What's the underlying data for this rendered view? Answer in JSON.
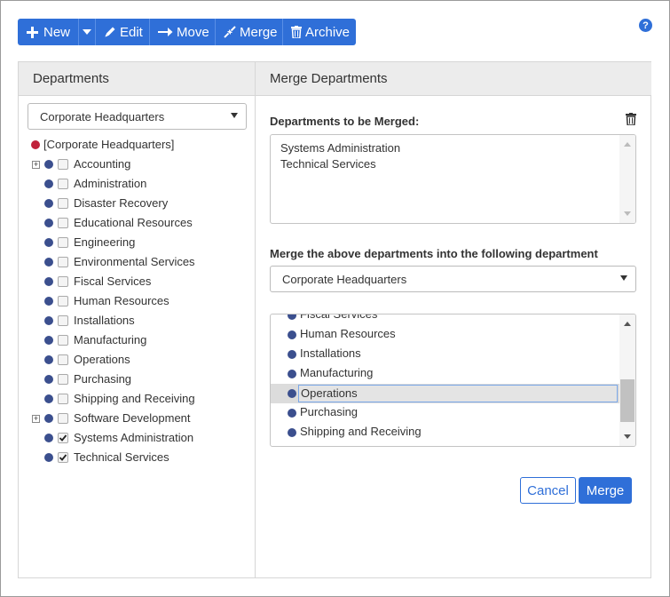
{
  "toolbar": {
    "new_label": "New",
    "edit_label": "Edit",
    "move_label": "Move",
    "merge_label": "Merge",
    "archive_label": "Archive"
  },
  "help_label": "?",
  "left_panel": {
    "title": "Departments",
    "select_value": "Corporate Headquarters",
    "root_label": "[Corporate Headquarters]",
    "items": [
      {
        "label": "Accounting",
        "expandable": true,
        "checked": false
      },
      {
        "label": "Administration",
        "expandable": false,
        "checked": false
      },
      {
        "label": "Disaster Recovery",
        "expandable": false,
        "checked": false
      },
      {
        "label": "Educational Resources",
        "expandable": false,
        "checked": false
      },
      {
        "label": "Engineering",
        "expandable": false,
        "checked": false
      },
      {
        "label": "Environmental Services",
        "expandable": false,
        "checked": false
      },
      {
        "label": "Fiscal Services",
        "expandable": false,
        "checked": false
      },
      {
        "label": "Human Resources",
        "expandable": false,
        "checked": false
      },
      {
        "label": "Installations",
        "expandable": false,
        "checked": false
      },
      {
        "label": "Manufacturing",
        "expandable": false,
        "checked": false
      },
      {
        "label": "Operations",
        "expandable": false,
        "checked": false
      },
      {
        "label": "Purchasing",
        "expandable": false,
        "checked": false
      },
      {
        "label": "Shipping and Receiving",
        "expandable": false,
        "checked": false
      },
      {
        "label": "Software Development",
        "expandable": true,
        "checked": false
      },
      {
        "label": "Systems Administration",
        "expandable": false,
        "checked": true
      },
      {
        "label": "Technical Services",
        "expandable": false,
        "checked": true
      }
    ]
  },
  "right_panel": {
    "title": "Merge Departments",
    "merged_label": "Departments to be Merged:",
    "merged_items": [
      "Systems Administration",
      "Technical Services"
    ],
    "into_label": "Merge the above departments into the following department",
    "target_select_value": "Corporate Headquarters",
    "target_list": [
      "Fiscal Services",
      "Human Resources",
      "Installations",
      "Manufacturing",
      "Operations",
      "Purchasing",
      "Shipping and Receiving"
    ],
    "target_selected": "Operations",
    "cancel_label": "Cancel",
    "merge_label": "Merge"
  },
  "colors": {
    "primary": "#2f6fd8",
    "node_dot": "#3b4f8e",
    "root_dot": "#c0223b"
  }
}
